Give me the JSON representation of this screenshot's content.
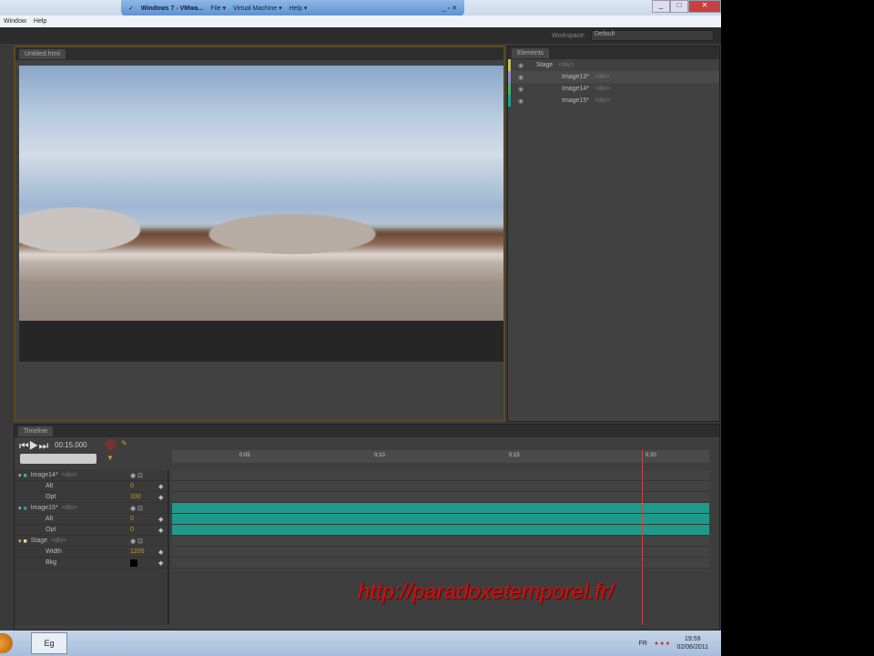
{
  "vmware": {
    "title": "Windows 7 - VMwa...",
    "menu": [
      "File ▾",
      "Virtual Machine ▾",
      "Help ▾"
    ]
  },
  "menu": [
    "Window",
    "Help"
  ],
  "workspace": {
    "label": "Workspace:",
    "value": "Default"
  },
  "stage_panel": {
    "tab": "Untitled.html"
  },
  "elements_panel": {
    "tab": "Elements",
    "items": [
      {
        "label": "Stage",
        "tag": "<div>"
      },
      {
        "label": "Image13*",
        "tag": "<div>"
      },
      {
        "label": "Image14*",
        "tag": "<div>"
      },
      {
        "label": "Image15*",
        "tag": "<div>"
      }
    ]
  },
  "timeline": {
    "tab": "Timeline",
    "time": "00:15.000",
    "ticks": [
      "0:05",
      "0:10",
      "0:15",
      "0:20"
    ],
    "rows": [
      {
        "label": "Image14*",
        "tag": "<div>",
        "type": "el"
      },
      {
        "label": "Alt",
        "value": "0",
        "type": "prop"
      },
      {
        "label": "Opt",
        "value": "100",
        "type": "prop"
      },
      {
        "label": "Image15*",
        "tag": "<div>",
        "type": "el"
      },
      {
        "label": "Alt",
        "value": "0",
        "type": "prop"
      },
      {
        "label": "Opt",
        "value": "0",
        "type": "prop"
      },
      {
        "label": "Stage",
        "tag": "<div>",
        "type": "el"
      },
      {
        "label": "Width",
        "value": "1200",
        "type": "prop"
      },
      {
        "label": "Bkg",
        "value": "",
        "type": "prop"
      }
    ]
  },
  "watermark": "http://paradoxetemporel.fr/",
  "taskbar": {
    "app": "Eg",
    "lang": "FR",
    "time": "19:59",
    "date": "02/06/2011"
  }
}
